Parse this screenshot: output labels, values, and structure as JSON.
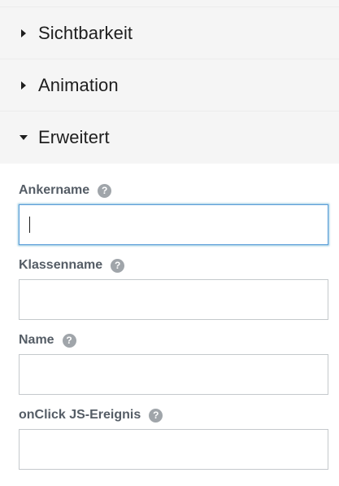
{
  "sections": [
    {
      "title": "Sichtbarkeit",
      "state": "collapsed"
    },
    {
      "title": "Animation",
      "state": "collapsed"
    },
    {
      "title": "Erweitert",
      "state": "expanded"
    }
  ],
  "advanced": {
    "fields": [
      {
        "label": "Ankername",
        "value": "",
        "focused": true
      },
      {
        "label": "Klassenname",
        "value": ""
      },
      {
        "label": "Name",
        "value": ""
      },
      {
        "label": "onClick JS-Ereignis",
        "value": ""
      }
    ],
    "help_glyph": "?"
  },
  "colors": {
    "header_bg": "#f5f5f5",
    "focus_border": "#5b9dd9",
    "label_text": "#555d66",
    "help_icon": "#a0a5aa"
  }
}
